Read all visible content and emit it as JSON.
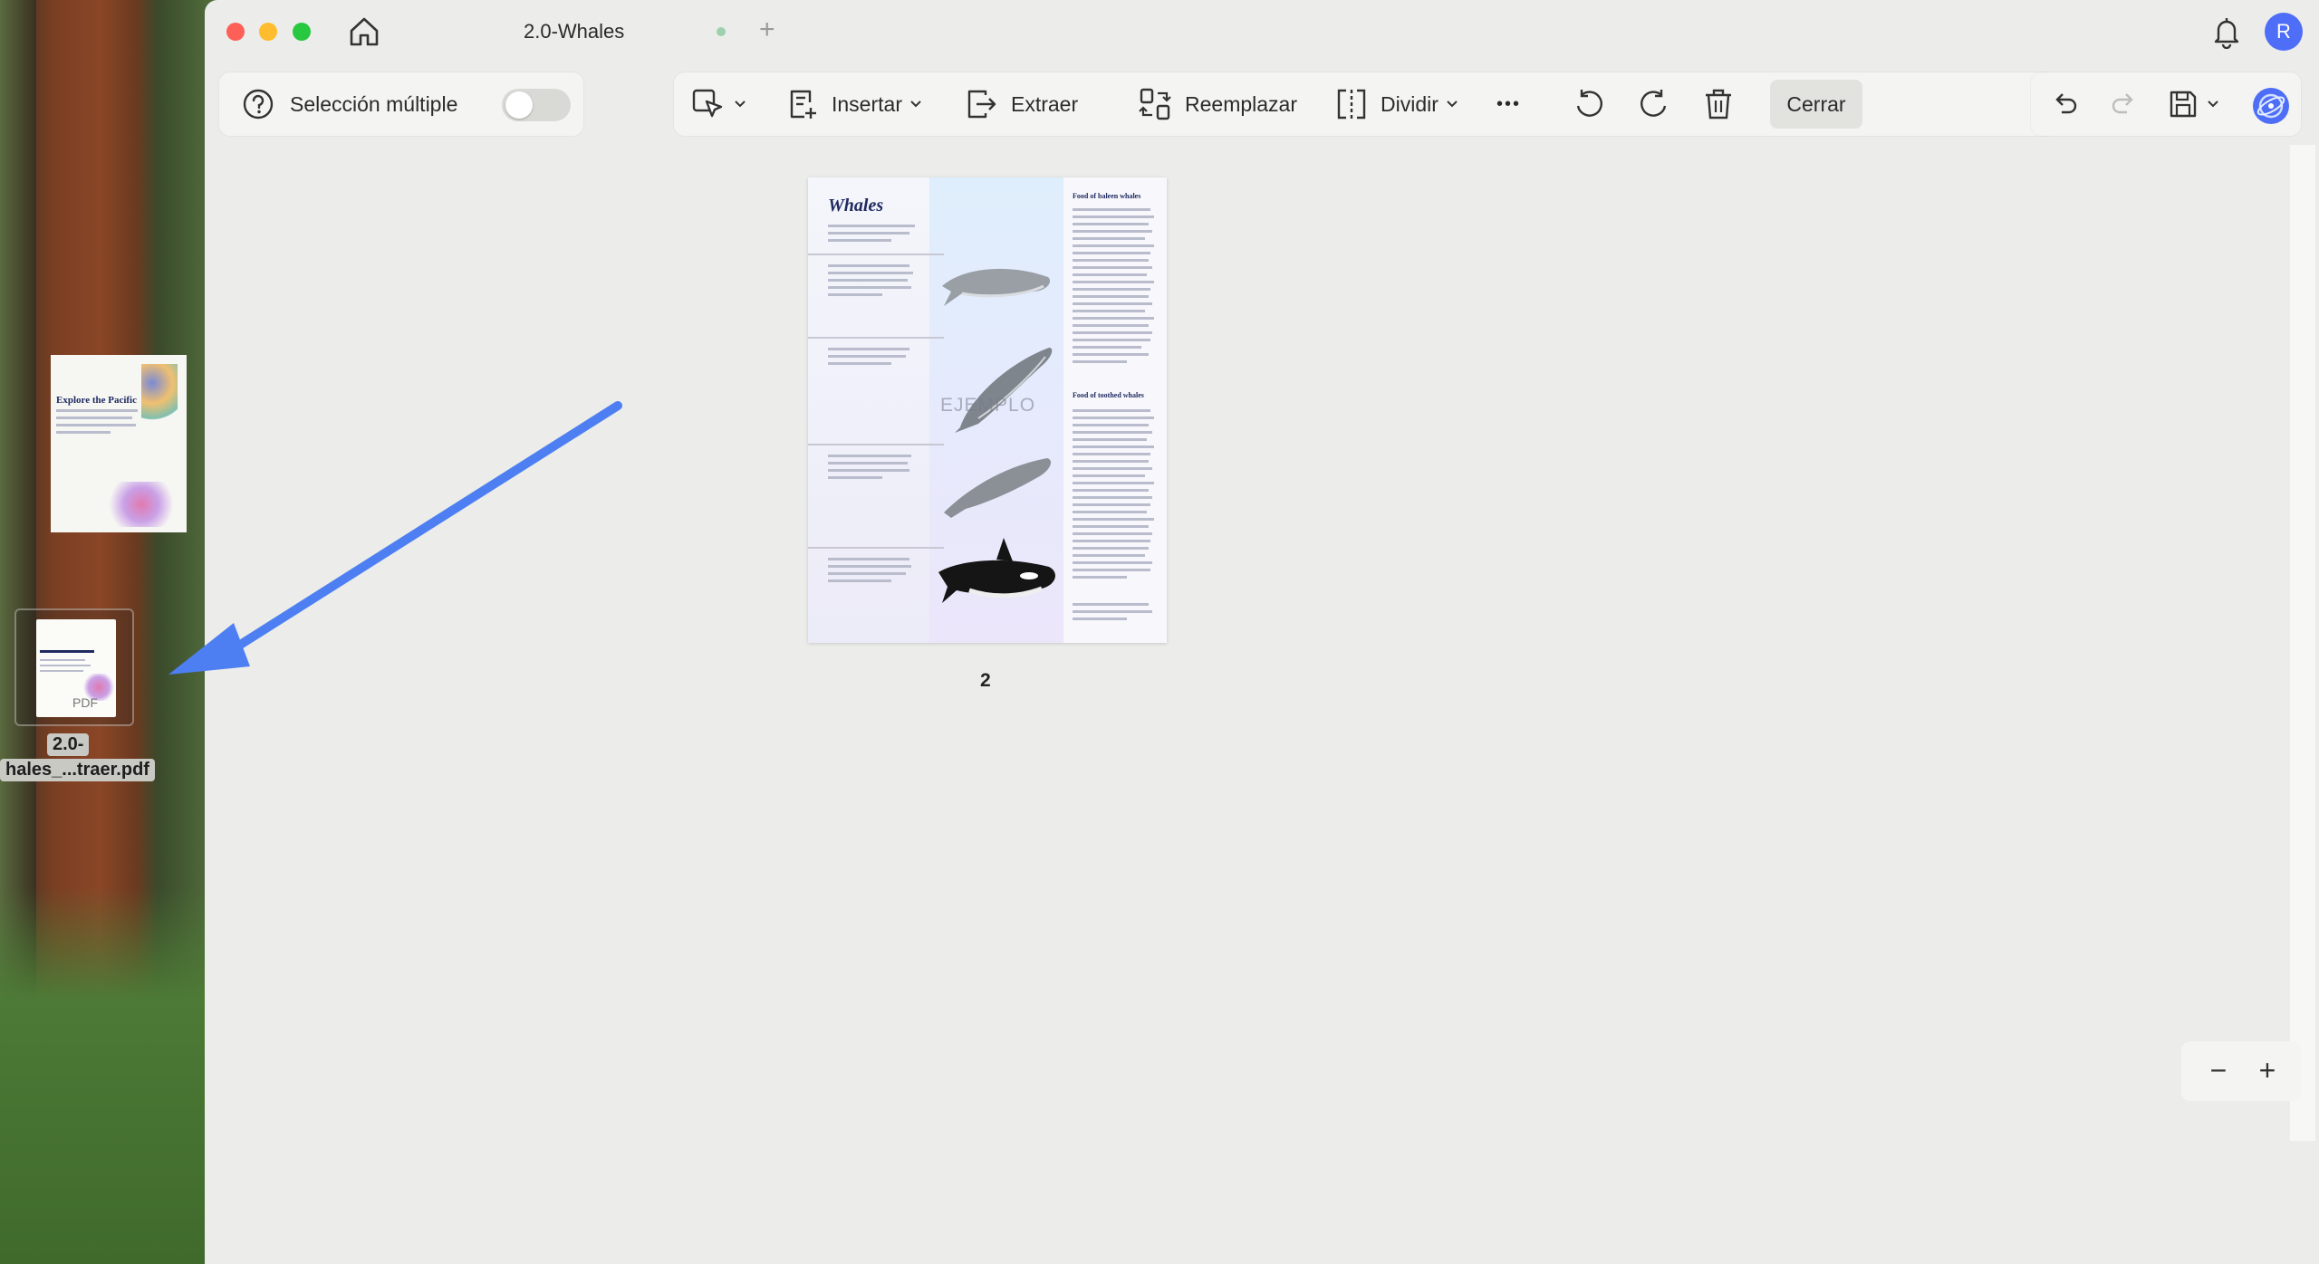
{
  "window": {
    "tab_title": "2.0-Whales",
    "tab_add": "+",
    "avatar_initial": "R"
  },
  "toolbar": {
    "multi_select_label": "Selección múltiple",
    "multi_select_on": false,
    "insert_label": "Insertar",
    "extract_label": "Extraer",
    "replace_label": "Reemplazar",
    "split_label": "Dividir",
    "more_label": "•••",
    "close_label": "Cerrar"
  },
  "page": {
    "title": "Whales",
    "watermark": "EJEMPLO",
    "heading_1": "Food of baleen whales",
    "heading_2": "Food of toothed whales",
    "number": "2"
  },
  "zoom": {
    "minus": "−",
    "plus": "+"
  },
  "drag_preview": {
    "subtitle": "Explore the Pacific"
  },
  "desktop_file": {
    "pdf_tag": "PDF",
    "name_line1": "2.0-",
    "name_line2": "hales_...traer.pdf"
  },
  "colors": {
    "accent": "#4f6ef7",
    "arrow": "#4e7ff2",
    "toolbar_bg": "#f4f4f2",
    "window_bg": "#ecedea"
  },
  "icons": [
    "home-icon",
    "bell-icon",
    "help-icon",
    "select-icon",
    "insert-icon",
    "extract-icon",
    "replace-icon",
    "split-icon",
    "rotate-left-icon",
    "rotate-right-icon",
    "trash-icon",
    "undo-icon",
    "redo-icon",
    "save-icon",
    "ai-assistant-icon"
  ]
}
